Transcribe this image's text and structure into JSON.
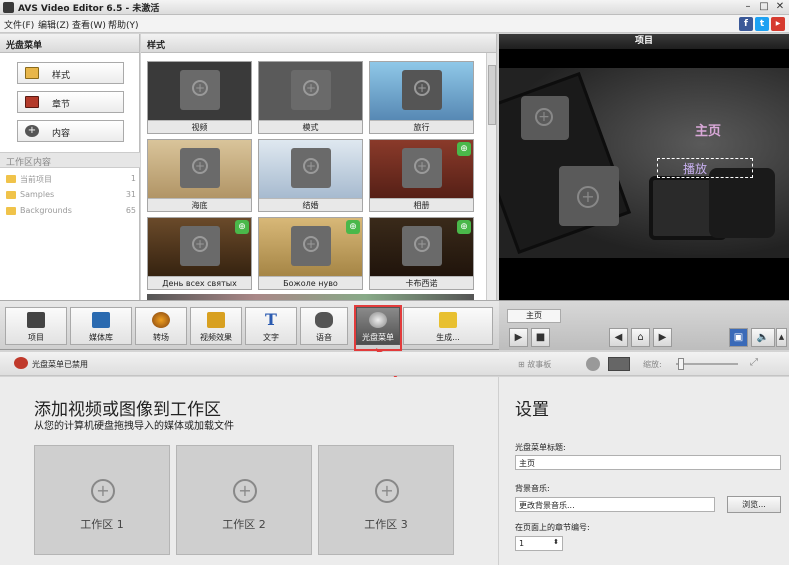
{
  "window": {
    "title": "AVS Video Editor 6.5 - 未激活"
  },
  "menu": [
    "文件(F)",
    "编辑(Z)",
    "查看(W)",
    "帮助(Y)"
  ],
  "left_panel": {
    "header": "光盘菜单",
    "nav": [
      {
        "label": "样式",
        "icon": "style-icon"
      },
      {
        "label": "章节",
        "icon": "chapter-icon"
      },
      {
        "label": "内容",
        "icon": "content-icon"
      }
    ],
    "workspace_header": "工作区内容",
    "workspace_items": [
      {
        "name": "当前项目",
        "count": "1"
      },
      {
        "name": "Samples",
        "count": "31"
      },
      {
        "name": "Backgrounds",
        "count": "65"
      }
    ]
  },
  "styles_panel": {
    "header": "样式",
    "thumbs": [
      "视频",
      "模式",
      "旅行",
      "海底",
      "结婚",
      "相册",
      "День всех святых",
      "Божоле нуво",
      "卡布西诺"
    ]
  },
  "preview": {
    "header": "项目",
    "title_text": "主页",
    "play_text": "播放"
  },
  "toolbar": {
    "buttons": [
      "项目",
      "媒体库",
      "转场",
      "视频效果",
      "文字",
      "语音",
      "光盘菜单",
      "生成..."
    ]
  },
  "player": {
    "page_tab": "主页"
  },
  "lower_bar": {
    "disc_status": "光盘菜单已禁用",
    "storyboard": "故事板",
    "zoom_label": "缩放:"
  },
  "workspace": {
    "title": "添加视频或图像到工作区",
    "subtitle": "从您的计算机硬盘拖拽导入的媒体或加载文件",
    "zones": [
      "工作区 1",
      "工作区 2",
      "工作区 3"
    ]
  },
  "settings": {
    "title": "设置",
    "menu_title_label": "光盘菜单标题:",
    "menu_title_value": "主页",
    "bg_music_label": "背景音乐:",
    "bg_music_value": "更改背景音乐...",
    "browse_label": "浏览...",
    "chapter_count_label": "在页面上的章节编号:",
    "chapter_count_value": "1"
  }
}
